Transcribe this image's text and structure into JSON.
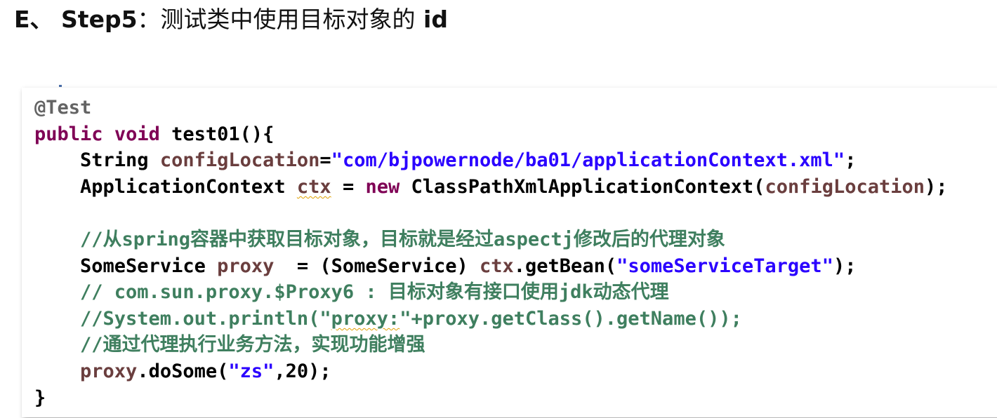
{
  "heading": {
    "prefix": "E、 ",
    "step": "Step5",
    "colon": "：",
    "title_cn": "测试类中使用目标对象的",
    "title_id": " id"
  },
  "code": {
    "annotation": "@Test",
    "kw_public": "public",
    "kw_void": "void",
    "method_sig": "test01(){",
    "type_string": "String",
    "var_configLocation": "configLocation",
    "eq": "=",
    "path_str": "\"com/bjpowernode/ba01/applicationContext.xml\"",
    "semi": ";",
    "type_appctx": "ApplicationContext",
    "var_ctx": "ctx",
    "eq_spaced": " = ",
    "kw_new": "new",
    "cls_impl": "ClassPathXmlApplicationContext(",
    "close_paren_semi": ");",
    "comment_1": "//从spring容器中获取目标对象，目标就是经过aspectj修改后的代理对象",
    "type_someservice": "SomeService",
    "var_proxy": "proxy",
    "cast": "  = (SomeService) ",
    "getbean_call": ".getBean(",
    "bean_str": "\"someServiceTarget\"",
    "comment_2": "// com.sun.proxy.$Proxy6 : 目标对象有接口使用jdk动态代理",
    "comment_3_prefix": "//System.out.println(\"",
    "comment_3_proxy": "proxy:",
    "comment_3_suffix": "\"+proxy.getClass().getName());",
    "comment_4": "//通过代理执行业务方法，实现功能增强",
    "dosome_call": ".doSome(",
    "zs_str": "\"zs\"",
    "dosome_args": ",20);",
    "close_brace": "}"
  },
  "colors": {
    "keyword": "#7f0055",
    "string": "#2a00ff",
    "variable": "#6a3e3e",
    "comment": "#3f7f5f",
    "annotation": "#646464"
  }
}
